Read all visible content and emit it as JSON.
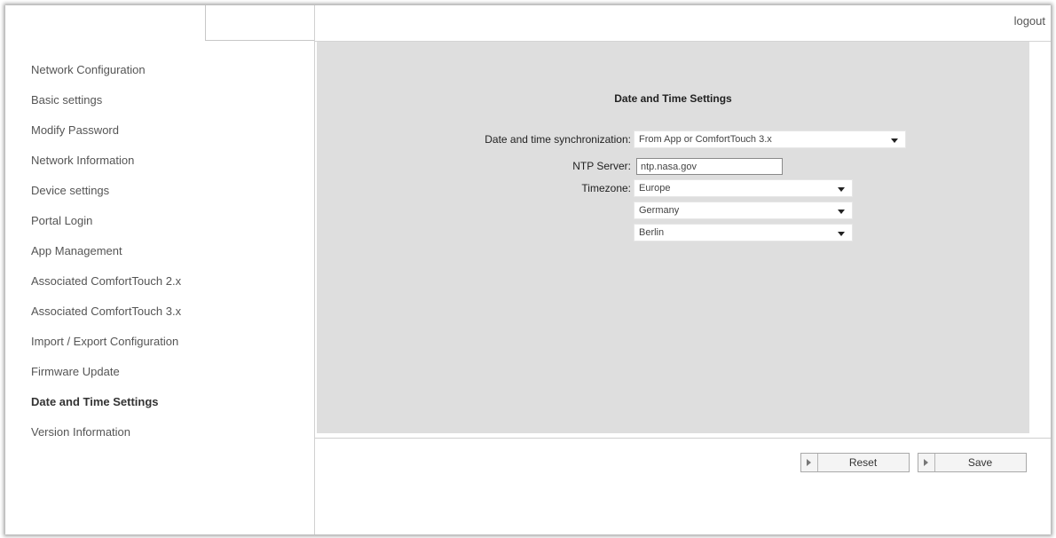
{
  "topbar": {
    "logout_label": "logout"
  },
  "sidebar": {
    "items": [
      {
        "label": "Network Configuration"
      },
      {
        "label": "Basic settings"
      },
      {
        "label": "Modify Password"
      },
      {
        "label": "Network Information"
      },
      {
        "label": "Device settings"
      },
      {
        "label": "Portal Login"
      },
      {
        "label": "App Management"
      },
      {
        "label": "Associated ComfortTouch 2.x"
      },
      {
        "label": "Associated ComfortTouch 3.x"
      },
      {
        "label": "Import / Export Configuration"
      },
      {
        "label": "Firmware Update"
      },
      {
        "label": "Date and Time Settings"
      },
      {
        "label": "Version Information"
      }
    ],
    "active_item": "Date and Time Settings"
  },
  "main": {
    "title": "Date and Time Settings",
    "sync": {
      "label": "Date and time synchronization:",
      "value": "From App or ComfortTouch 3.x"
    },
    "ntp": {
      "label": "NTP Server:",
      "value": "ntp.nasa.gov"
    },
    "timezone": {
      "label": "Timezone:",
      "region": "Europe",
      "country": "Germany",
      "city": "Berlin"
    }
  },
  "buttons": {
    "reset_label": "Reset",
    "save_label": "Save"
  },
  "icons": {
    "dropdown": "chevron-down-icon",
    "button_arrow": "play-arrow-icon"
  },
  "colors": {
    "content_bg": "#dedede",
    "border": "#d0d0d0"
  }
}
